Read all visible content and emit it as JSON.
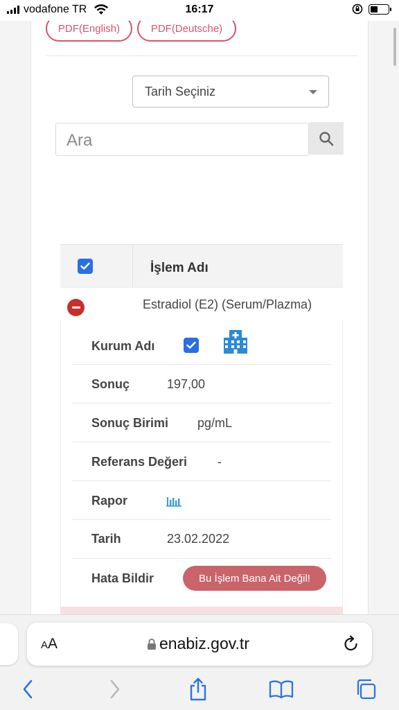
{
  "status_bar": {
    "carrier": "vodafone TR",
    "time": "16:17"
  },
  "pdf_buttons": {
    "english": "PDF(English)",
    "deutsche": "PDF(Deutsche)"
  },
  "filters": {
    "date_select": "Tarih Seçiniz",
    "search_placeholder": "Ara"
  },
  "table": {
    "header": "İşlem Adı",
    "row_name": "Estradiol (E2) (Serum/Plazma)",
    "details": {
      "institution_label": "Kurum Adı",
      "result_label": "Sonuç",
      "result_value": "197,00",
      "unit_label": "Sonuç Birimi",
      "unit_value": "pg/mL",
      "reference_label": "Referans Değeri",
      "reference_value": "-",
      "report_label": "Rapor",
      "date_label": "Tarih",
      "date_value": "23.02.2022",
      "report_error_label": "Hata Bildir",
      "report_error_button": "Bu İşlem Bana Ait Değil!"
    }
  },
  "browser": {
    "aa_label_small": "A",
    "aa_label_large": "A",
    "url": "enabiz.gov.tr"
  },
  "colors": {
    "accent": "#d6546f",
    "checkbox": "#2a6fe3",
    "remove": "#c62f2f",
    "error_button": "#c9646b",
    "icon_blue": "#2a8ad8"
  }
}
